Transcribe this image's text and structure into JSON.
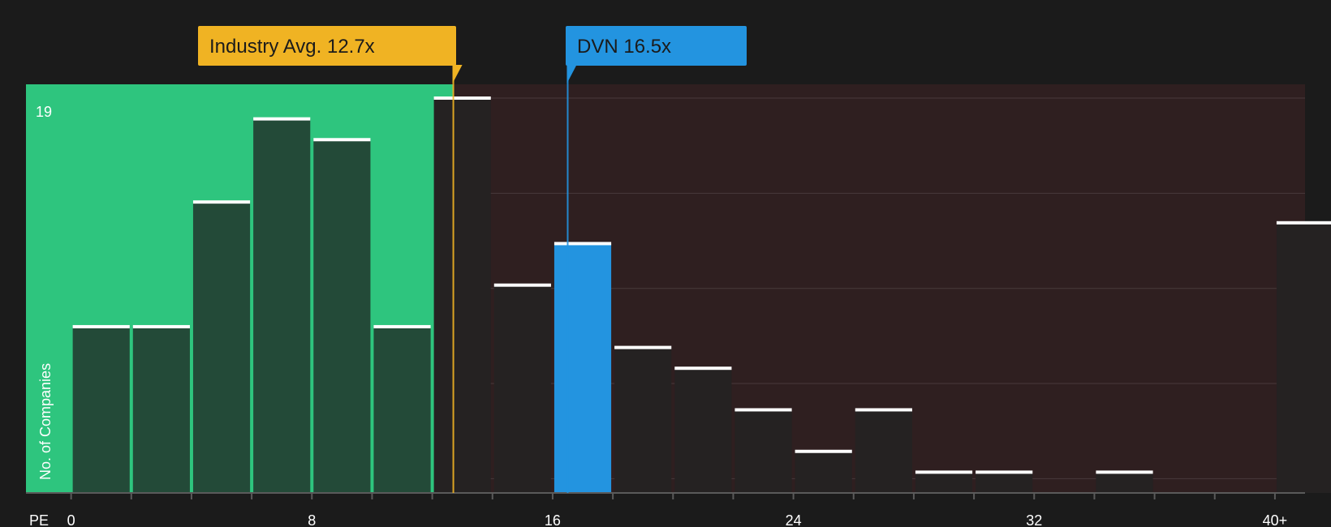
{
  "chart_data": {
    "type": "bar",
    "xlabel": "PE",
    "ylabel": "No. of Companies",
    "x_ticks": [
      "0",
      "8",
      "16",
      "24",
      "32",
      "40+"
    ],
    "x_tick_values": [
      0,
      8,
      16,
      24,
      32,
      40
    ],
    "y_top_label": "19",
    "ylim": [
      0,
      19
    ],
    "xlim": [
      -1.5,
      41
    ],
    "bin_width": 2,
    "bins": [
      {
        "start": 0,
        "value": 8
      },
      {
        "start": 2,
        "value": 8
      },
      {
        "start": 4,
        "value": 14
      },
      {
        "start": 6,
        "value": 18
      },
      {
        "start": 8,
        "value": 17
      },
      {
        "start": 10,
        "value": 8
      },
      {
        "start": 12,
        "value": 19
      },
      {
        "start": 14,
        "value": 10
      },
      {
        "start": 16,
        "value": 12,
        "highlight": true
      },
      {
        "start": 18,
        "value": 7
      },
      {
        "start": 20,
        "value": 6
      },
      {
        "start": 22,
        "value": 4
      },
      {
        "start": 24,
        "value": 2
      },
      {
        "start": 26,
        "value": 4
      },
      {
        "start": 28,
        "value": 1
      },
      {
        "start": 30,
        "value": 1
      },
      {
        "start": 34,
        "value": 1
      },
      {
        "start": 40,
        "value": 13
      }
    ],
    "industry_avg": {
      "label": "Industry Avg. 12.7x",
      "value": 12.7
    },
    "company": {
      "label": "DVN 16.5x",
      "value": 16.5
    },
    "grid": true,
    "colors": {
      "background": "#1b1b1b",
      "good_zone": "#2ec57e",
      "bad_zone": "#2f1f20",
      "bar_in_good_zone": "#234a38",
      "bar_in_bad_zone": "#252222",
      "highlight_bar": "#2394e0",
      "bar_cap": "#ffffff",
      "industry_callout": "#f0b323",
      "company_callout": "#2394e0"
    }
  }
}
